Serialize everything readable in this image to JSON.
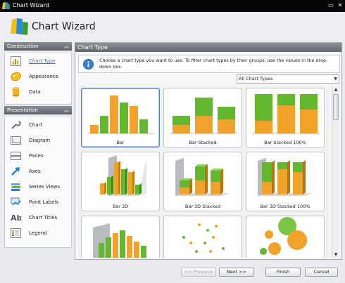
{
  "window": {
    "title": "Chart Wizard"
  },
  "header": {
    "title": "Chart Wizard"
  },
  "construction": {
    "title": "Construction",
    "items": [
      {
        "label": "Chart Type",
        "active": true
      },
      {
        "label": "Appearance"
      },
      {
        "label": "Data"
      }
    ]
  },
  "presentation": {
    "title": "Presentation",
    "items": [
      {
        "label": "Chart"
      },
      {
        "label": "Diagram"
      },
      {
        "label": "Panes"
      },
      {
        "label": "Axes"
      },
      {
        "label": "Series Views"
      },
      {
        "label": "Point Labels"
      },
      {
        "label": "Chart Titles"
      },
      {
        "label": "Legend"
      }
    ]
  },
  "main": {
    "title": "Chart Type",
    "info": "Choose a chart type you want to use. To filter chart types by their groups, use the values in the drop-down box.",
    "filter": {
      "selected": "All Chart Types"
    },
    "tiles": [
      {
        "label": "Bar",
        "selected": true
      },
      {
        "label": "Bar Stacked"
      },
      {
        "label": "Bar Stacked 100%"
      },
      {
        "label": "Bar 3D"
      },
      {
        "label": "Bar 3D Stacked"
      },
      {
        "label": "Bar 3D Stacked 100%"
      },
      {
        "label": ""
      },
      {
        "label": ""
      },
      {
        "label": ""
      }
    ]
  },
  "footer": {
    "previous": "<< Previous",
    "next": "Next >>",
    "finish": "Finish",
    "cancel": "Cancel"
  },
  "colors": {
    "orange": "#f0a22b",
    "green": "#63b830",
    "header_gray": "#6a6e74",
    "selection": "#5a7fbf"
  }
}
